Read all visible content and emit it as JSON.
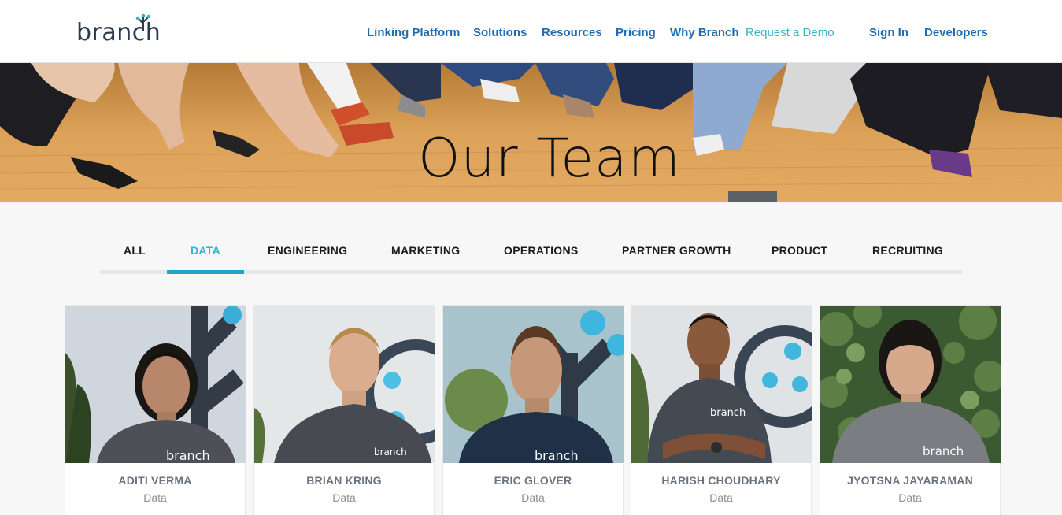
{
  "brand": {
    "logo_text": "branch"
  },
  "nav": {
    "items": [
      "Linking Platform",
      "Solutions",
      "Resources",
      "Pricing",
      "Why Branch"
    ],
    "demo": "Request a Demo",
    "sign_in": "Sign In",
    "developers": "Developers"
  },
  "hero": {
    "title": "Our Team"
  },
  "tabs": {
    "items": [
      "ALL",
      "DATA",
      "ENGINEERING",
      "MARKETING",
      "OPERATIONS",
      "PARTNER GROWTH",
      "PRODUCT",
      "RECRUITING"
    ],
    "active": "DATA"
  },
  "team": [
    {
      "name": "ADITI VERMA",
      "dept": "Data"
    },
    {
      "name": "BRIAN KRING",
      "dept": "Data"
    },
    {
      "name": "ERIC GLOVER",
      "dept": "Data"
    },
    {
      "name": "HARISH CHOUDHARY",
      "dept": "Data"
    },
    {
      "name": "JYOTSNA JAYARAMAN",
      "dept": "Data"
    }
  ],
  "shirt_text": "branch",
  "colors": {
    "nav_link": "#1f6cb0",
    "accent": "#2cb5d4",
    "logo": "#2d3b4a"
  }
}
